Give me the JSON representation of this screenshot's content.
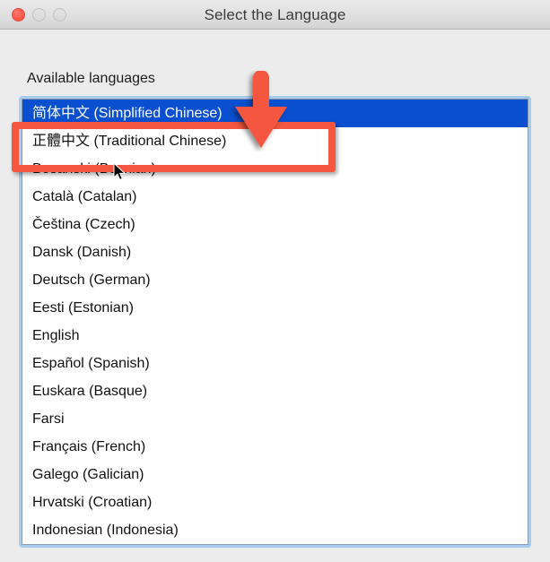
{
  "window": {
    "title": "Select the Language",
    "traffic_lights": [
      {
        "name": "close",
        "color": "#fb5a4c",
        "enabled": true
      },
      {
        "name": "minimize",
        "color": "#dcdcdc",
        "enabled": false
      },
      {
        "name": "maximize",
        "color": "#dcdcdc",
        "enabled": false
      }
    ],
    "titlebar_color": "#e2e2e2",
    "content_background": "#ececec"
  },
  "content": {
    "available_label": "Available languages",
    "list": {
      "selected_index": 0,
      "selection_color": "#0a4fd0",
      "focus_ring_color": "#a8cbf0",
      "border_color": "#8a9bb0",
      "background": "#ffffff",
      "items": [
        {
          "label": "简体中文 (Simplified Chinese)",
          "selected": true
        },
        {
          "label": "正體中文 (Traditional Chinese)",
          "selected": false
        },
        {
          "label": "Bosanski (Bosnian)",
          "selected": false
        },
        {
          "label": "Català (Catalan)",
          "selected": false
        },
        {
          "label": "Čeština (Czech)",
          "selected": false
        },
        {
          "label": "Dansk (Danish)",
          "selected": false
        },
        {
          "label": "Deutsch (German)",
          "selected": false
        },
        {
          "label": "Eesti (Estonian)",
          "selected": false
        },
        {
          "label": "English",
          "selected": false
        },
        {
          "label": "Español (Spanish)",
          "selected": false
        },
        {
          "label": "Euskara (Basque)",
          "selected": false
        },
        {
          "label": "Farsi",
          "selected": false
        },
        {
          "label": "Français (French)",
          "selected": false
        },
        {
          "label": "Galego (Galician)",
          "selected": false
        },
        {
          "label": "Hrvatski (Croatian)",
          "selected": false
        },
        {
          "label": "Indonesian (Indonesia)",
          "selected": false
        }
      ]
    }
  },
  "annotations": {
    "highlight_color": "#f4563f",
    "box_target": "简体中文 (Simplified Chinese)",
    "arrow_direction": "down"
  }
}
